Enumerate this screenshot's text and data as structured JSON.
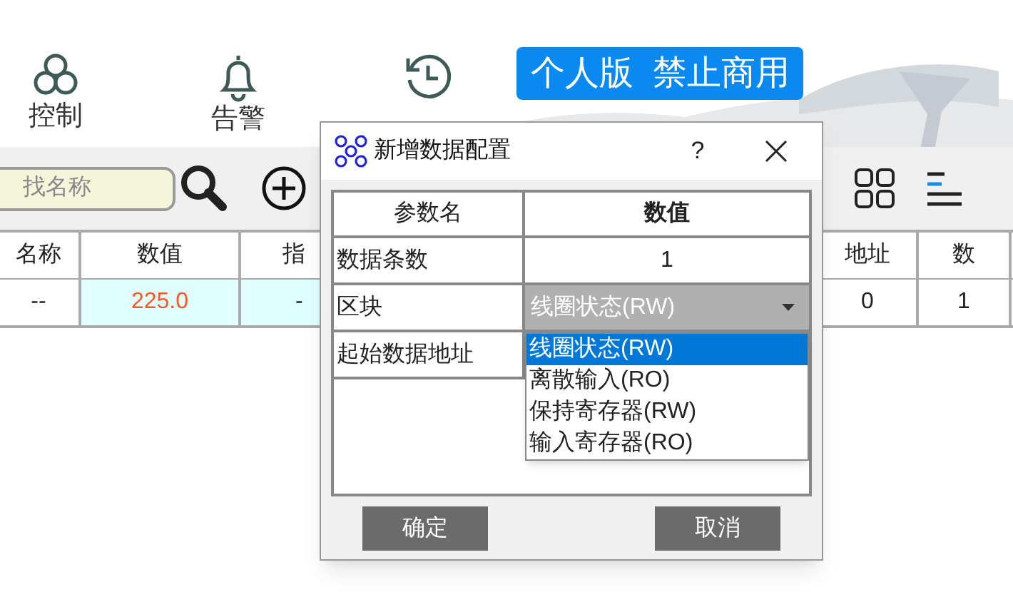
{
  "toolbar": {
    "items": [
      {
        "kind": "link",
        "label": "控制"
      },
      {
        "kind": "bell",
        "label": "告警"
      },
      {
        "kind": "history"
      }
    ]
  },
  "badge": "个人版  禁止商用",
  "search": {
    "placeholder": "找名称"
  },
  "table": {
    "columns": [
      "名称",
      "数值",
      "指",
      "地址",
      "数"
    ],
    "rows": [
      [
        "--",
        "225.0",
        "-",
        "0",
        "1"
      ]
    ]
  },
  "dialog": {
    "title": "新增数据配置",
    "help": "?",
    "columns": [
      "参数名",
      "数值"
    ],
    "rows": [
      {
        "kind": "text",
        "name": "数据条数",
        "value": "1"
      },
      {
        "kind": "combo",
        "name": "区块",
        "value": "线圈状态(RW)",
        "expanded": true,
        "options": [
          {
            "label": "线圈状态(RW)",
            "selected": true
          },
          {
            "label": "离散输入(RO)",
            "selected": false
          },
          {
            "label": "保持寄存器(RW)",
            "selected": false
          },
          {
            "label": "输入寄存器(RO)",
            "selected": false
          }
        ]
      },
      {
        "kind": "text",
        "name": "起始数据地址"
      }
    ],
    "buttons": [
      "确定",
      "取消"
    ]
  }
}
